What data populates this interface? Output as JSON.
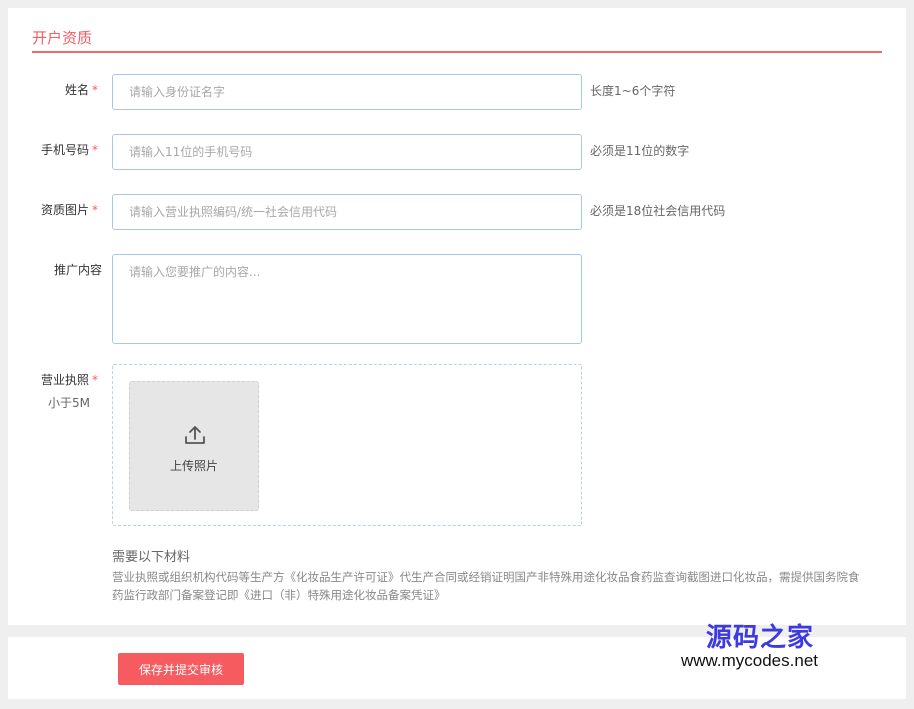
{
  "section": {
    "title": "开户资质"
  },
  "form": {
    "name": {
      "label": "姓名",
      "required_mark": "*",
      "placeholder": "请输入身份证名字",
      "hint": "长度1~6个字符"
    },
    "phone": {
      "label": "手机号码",
      "required_mark": "*",
      "placeholder": "请输入11位的手机号码",
      "hint": "必须是11位的数字"
    },
    "credential": {
      "label": "资质图片",
      "required_mark": "*",
      "placeholder": "请输入营业执照编码/统一社会信用代码",
      "hint": "必须是18位社会信用代码"
    },
    "promotion": {
      "label": "推广内容",
      "placeholder": "请输入您要推广的内容..."
    },
    "license": {
      "label": "营业执照",
      "required_mark": "*",
      "sublabel": "小于5M",
      "upload_text": "上传照片"
    }
  },
  "materials": {
    "title": "需要以下材料",
    "description": "营业执照或组织机构代码等生产方《化妆品生产许可证》代生产合同或经销证明国产非特殊用途化妆品食药监查询截图进口化妆品，需提供国务院食药监行政部门备案登记即《进口（非）特殊用途化妆品备案凭证》"
  },
  "footer": {
    "submit_label": "保存并提交审核"
  },
  "watermark": {
    "brand": "源码之家",
    "url": "www.mycodes.net"
  },
  "colors": {
    "accent": "#f25d63",
    "input_border": "#aac6e6",
    "watermark_brand": "#3d3ae0"
  }
}
